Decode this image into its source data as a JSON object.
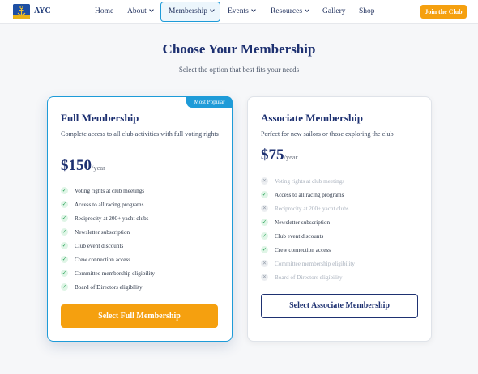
{
  "nav": {
    "logo_text": "AYC",
    "items": [
      {
        "label": "Home",
        "has_caret": false
      },
      {
        "label": "About",
        "has_caret": true
      },
      {
        "label": "Membership",
        "has_caret": true,
        "active": true
      },
      {
        "label": "Events",
        "has_caret": true
      },
      {
        "label": "Resources",
        "has_caret": true
      },
      {
        "label": "Gallery",
        "has_caret": false
      },
      {
        "label": "Shop",
        "has_caret": false
      }
    ],
    "join_label": "Join the Club"
  },
  "main": {
    "title": "Choose Your Membership",
    "subtitle": "Select the option that best fits your needs"
  },
  "plans": [
    {
      "badge": "Most Popular",
      "title": "Full Membership",
      "description": "Complete access to all club activities with full voting rights",
      "price": "$150",
      "period": "/year",
      "features": [
        {
          "text": "Voting rights at club meetings",
          "included": true
        },
        {
          "text": "Access to all racing programs",
          "included": true
        },
        {
          "text": "Reciprocity at 200+ yacht clubs",
          "included": true
        },
        {
          "text": "Newsletter subscription",
          "included": true
        },
        {
          "text": "Club event discounts",
          "included": true
        },
        {
          "text": "Crew connection access",
          "included": true
        },
        {
          "text": "Committee membership eligibility",
          "included": true
        },
        {
          "text": "Board of Directors eligibility",
          "included": true
        }
      ],
      "button": "Select Full Membership"
    },
    {
      "title": "Associate Membership",
      "description": "Perfect for new sailors or those exploring the club",
      "price": "$75",
      "period": "/year",
      "features": [
        {
          "text": "Voting rights at club meetings",
          "included": false
        },
        {
          "text": "Access to all racing programs",
          "included": true
        },
        {
          "text": "Reciprocity at 200+ yacht clubs",
          "included": false
        },
        {
          "text": "Newsletter subscription",
          "included": true
        },
        {
          "text": "Club event discounts",
          "included": true
        },
        {
          "text": "Crew connection access",
          "included": true
        },
        {
          "text": "Committee membership eligibility",
          "included": false
        },
        {
          "text": "Board of Directors eligibility",
          "included": false
        }
      ],
      "button": "Select Associate Membership"
    }
  ],
  "icons": {
    "included": "check-icon",
    "excluded": "x-icon"
  },
  "colors": {
    "accent": "#1e9bd8",
    "primary": "#1e3171",
    "cta": "#f5a00f",
    "check": "#2aa35a"
  }
}
